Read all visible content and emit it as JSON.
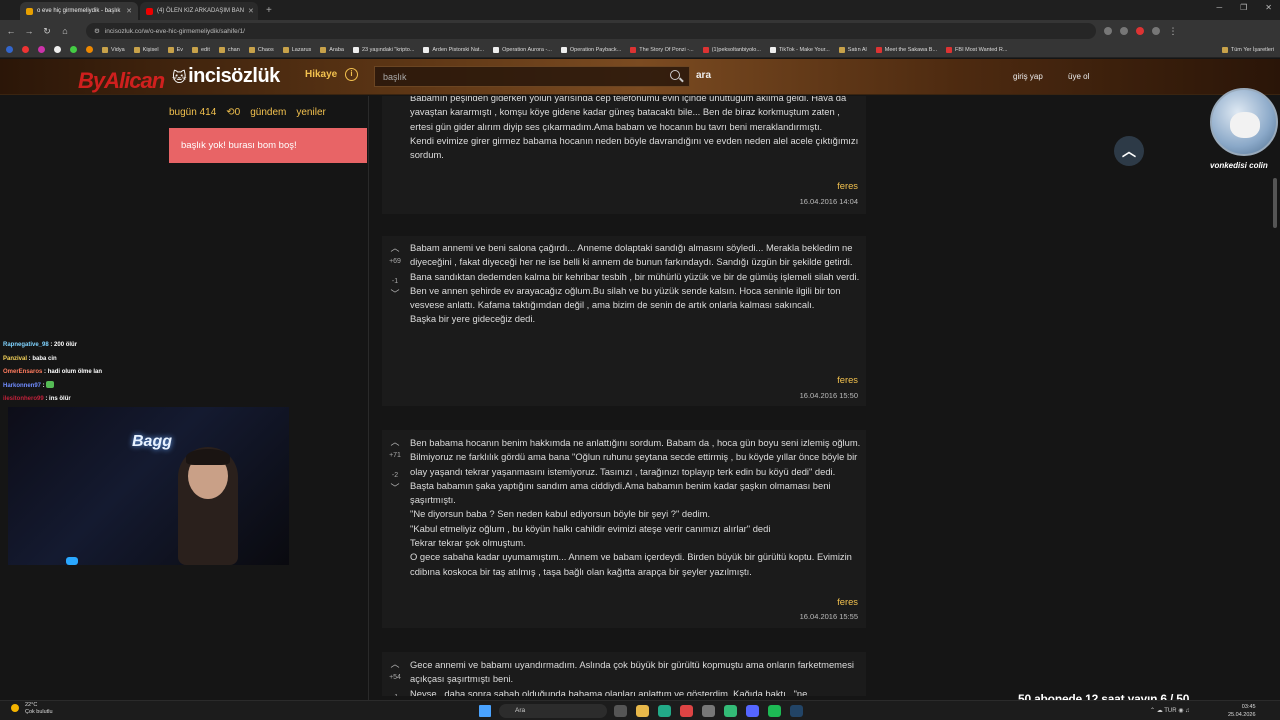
{
  "browser": {
    "tabs": [
      {
        "title": "o eve hiç girmemeliydik - başlık",
        "active": true
      },
      {
        "title": "(4) ÖLEN KIZ ARKADAŞIM BAN",
        "active": false
      }
    ],
    "url": "incisozluk.co/w/o-eve-hic-girmemeliydik/sahife/1/",
    "bookmarks": [
      "Vidya",
      "Kişisel",
      "Ev",
      "edit",
      "chan",
      "Chaos",
      "Lazarus",
      "Araba",
      "23 yaşındaki \"kripto...",
      "Arden Pistorski Nat...",
      "Operation Aurora -...",
      "Operation Payback...",
      "The Story Of Ponzi -...",
      "(1)peksoltanbiyolo...",
      "TikTok - Make Your...",
      "Satın Al",
      "Meet the Sakawa B...",
      "FBI Most Wanted R..."
    ],
    "bookmarks_other": "Tüm Yer İşaretleri"
  },
  "site": {
    "logo": "incisözlük",
    "hikaye": "Hikaye",
    "search_placeholder": "başlık",
    "search_button": "ara",
    "login": "giriş yap",
    "register": "üye ol",
    "stream_logo": "ByAlican"
  },
  "sidebar": {
    "today": "bugün 414",
    "reply_count": "0",
    "gundem": "gündem",
    "yeniler": "yeniler",
    "alert": "başlık yok! burası bom boş!"
  },
  "entries": [
    {
      "vote_up": "",
      "vote_down": "",
      "text": "Babamın peşinden giderken yolun yarısında cep telefonumu evin içinde unuttuğum aklıma geldi. Hava da yavaştan kararmıştı , komşu köye gidene kadar güneş batacaktı bile... Ben de biraz korkmuştum zaten , ertesi gün gider alırım diyip ses çıkarmadım.Ama babam ve hocanın bu tavrı beni meraklandırmıştı.\nKendi evimize girer girmez babama hocanın neden böyle davrandığını ve evden neden alel acele çıktığımızı sordum.",
      "author": "feres",
      "date": "16.04.2016 14:04"
    },
    {
      "vote_up": "+69",
      "vote_down": "-1",
      "text": "Babam annemi ve beni salona çağırdı... Anneme dolaptaki sandığı almasını söyledi... Merakla bekledim ne diyeceğini , fakat diyeceği her ne ise belli ki annem de bunun farkındaydı. Sandığı üzgün bir şekilde getirdi.\nBana sandıktan dedemden kalma bir kehribar tesbih , bir mühürlü yüzük ve bir de gümüş işlemeli silah verdi.\nBen ve annen şehirde ev arayacağız oğlum.Bu silah ve bu yüzük sende kalsın. Hoca seninle ilgili bir ton vesvese anlattı. Kafama taktığımdan değil , ama bizim de senin de artık onlarla kalması sakıncalı.\nBaşka bir yere gideceğiz dedi.",
      "author": "feres",
      "date": "16.04.2016 15:50"
    },
    {
      "vote_up": "+71",
      "vote_down": "-2",
      "text": "Ben babama hocanın benim hakkımda ne anlattığını sordum. Babam da , hoca gün boyu seni izlemiş oğlum. Bilmiyoruz ne farklılık gördü ama bana \"Oğlun ruhunu şeytana secde ettirmiş , bu köyde yıllar önce böyle bir olay yaşandı tekrar yaşanmasını istemiyoruz. Tasınızı , tarağınızı toplayıp terk edin bu köyü dedi\" dedi.\nBaşta babamın şaka yaptığını sandım ama ciddiydi.Ama babamın benim kadar şaşkın olmaması beni şaşırtmıştı.\n\"Ne diyorsun baba ? Sen neden kabul ediyorsun böyle bir şeyi ?\" dedim.\n\"Kabul etmeliyiz oğlum , bu köyün halkı cahildir evimizi ateşe verir canımızı alırlar\" dedi\nTekrar tekrar şok olmuştum.\nO gece sabaha kadar uyumamıştım... Annem ve babam içerdeydi. Birden büyük bir gürültü koptu. Evimizin cdibına koskoca bir taş atılmış , taşa bağlı olan kağıtta arapça bir şeyler yazılmıştı.",
      "author": "feres",
      "date": "16.04.2016 15:55"
    },
    {
      "vote_up": "+54",
      "vote_down": "-1",
      "text": "Gece annemi ve babamı uyandırmadım. Aslında çok büyük bir gürültü kopmuştu ama onların farketmemesi açıkçası şaşırtmıştı beni.\nNeyse , daha sonra sabah olduğunda babama olanları anlattım ve gösterdim. Kağıda baktı , \"ne",
      "author": "",
      "date": ""
    }
  ],
  "right": {
    "avatar_name": "vonkedisi colin"
  },
  "chat": [
    {
      "user": "Rapnegative_98",
      "msg": "200 ölür",
      "cls": "u1"
    },
    {
      "user": "Panzival",
      "msg": "baba cin",
      "cls": "u2"
    },
    {
      "user": "OmerEnsaros",
      "msg": "hadi olum ölme lan",
      "cls": "u3"
    },
    {
      "user": "Harkonnen97",
      "msg": "",
      "cls": "u4"
    },
    {
      "user": "ilesitonhero99",
      "msg": "ins ölür",
      "cls": "u5"
    }
  ],
  "webcam": {
    "neon": "Bagg"
  },
  "stream_overlay": "50 abonede 12 saat yayın 6 / 50",
  "taskbar": {
    "weather_temp": "22°C",
    "weather_desc": "Çok bulutlu",
    "search_placeholder": "Ara",
    "lang": "TUR",
    "time": "03:45",
    "date": "25.04.2026"
  },
  "colors": {
    "accent": "#f2c14e",
    "alert_bg": "#e86466",
    "entry_bg": "#1b1b1b"
  }
}
